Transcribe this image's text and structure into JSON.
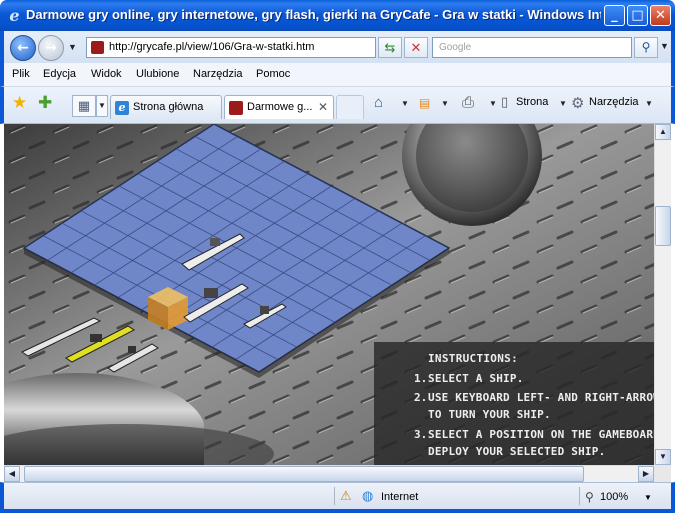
{
  "window": {
    "title": "Darmowe gry online, gry internetowe, gry flash, gierki na GryCafe - Gra w statki - Windows Internet Explorer",
    "minimize": "_",
    "maximize": "□",
    "close": "✕"
  },
  "address": {
    "url": "http://grycafe.pl/view/106/Gra-w-statki.htm",
    "search_placeholder": "Google"
  },
  "menu": {
    "items": [
      "Plik",
      "Edycja",
      "Widok",
      "Ulubione",
      "Narzędzia",
      "Pomoc"
    ]
  },
  "tabs": [
    {
      "label": "Strona główna",
      "active": false
    },
    {
      "label": "Darmowe g...",
      "active": true
    }
  ],
  "commands": {
    "page": "Strona",
    "tools": "Narzędzia"
  },
  "game": {
    "instructions_title": "INSTRUCTIONS:",
    "steps": [
      {
        "num": "1.",
        "lines": [
          "SELECT A SHIP."
        ]
      },
      {
        "num": "2.",
        "lines": [
          "USE KEYBOARD LEFT- AND RIGHT-ARROW KEYS",
          "TO TURN YOUR SHIP."
        ]
      },
      {
        "num": "3.",
        "lines": [
          "SELECT A POSITION ON THE GAMEBOARD TO",
          "DEPLOY YOUR SELECTED SHIP."
        ]
      }
    ],
    "board_color": "#6f86c9",
    "highlight_color": "#e8a83a",
    "selected_ship_color": "#e0e020"
  },
  "status": {
    "zone": "Internet",
    "zoom": "100%"
  },
  "colors": {
    "window_frame": "#0b58d6"
  }
}
